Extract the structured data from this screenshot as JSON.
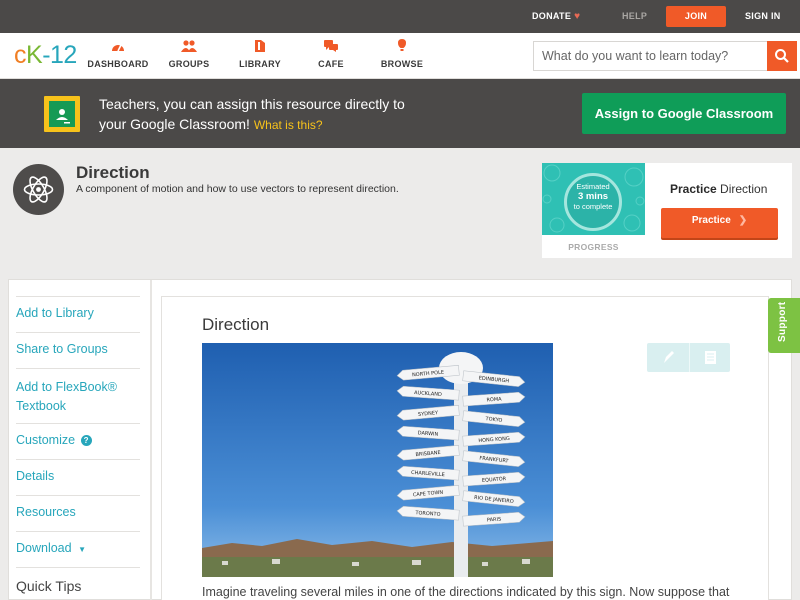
{
  "topbar": {
    "donate": "DONATE",
    "help": "HELP",
    "join": "JOIN",
    "signin": "SIGN IN"
  },
  "logo": {
    "c": "c",
    "k": "K",
    "n": "-12"
  },
  "nav": [
    {
      "label": "DASHBOARD",
      "icon": "dashboard-icon"
    },
    {
      "label": "GROUPS",
      "icon": "groups-icon"
    },
    {
      "label": "LIBRARY",
      "icon": "library-icon"
    },
    {
      "label": "CAFE",
      "icon": "cafe-icon"
    },
    {
      "label": "BROWSE",
      "icon": "browse-icon"
    }
  ],
  "search": {
    "placeholder": "What do you want to learn today?"
  },
  "banner": {
    "line1": "Teachers, you can assign this resource directly to",
    "line2": "your Google Classroom!",
    "link": "What is this?",
    "button": "Assign to Google Classroom"
  },
  "concept": {
    "title": "Direction",
    "description": "A component of motion and how to use vectors to represent direction."
  },
  "progress": {
    "estimated": "Estimated",
    "mins": "3 mins",
    "complete": "to complete",
    "label": "PROGRESS",
    "practice_bold": "Practice",
    "practice_rest": "Direction",
    "practice_button": "Practice"
  },
  "sidebar": {
    "items": [
      "Add to Library",
      "Share to Groups",
      "Add to FlexBook®",
      "Textbook",
      "Customize",
      "Details",
      "Resources",
      "Download"
    ],
    "quick_tips": "Quick Tips"
  },
  "article": {
    "title": "Direction",
    "text": "Imagine traveling several miles in one of the directions indicated by this sign. Now suppose that",
    "signs": [
      "NORTH POLE",
      "EDINBURGH",
      "AUCKLAND",
      "ROMA",
      "SYDNEY",
      "TOKYO",
      "DARWIN",
      "HONG KONG",
      "BRISBANE",
      "FRANKFURT",
      "CHARLEVILLE",
      "EQUATOR",
      "CAPE TOWN",
      "RIO DE JANEIRO",
      "TORONTO",
      "PARIS"
    ]
  },
  "support": "Support",
  "colors": {
    "accent": "#f05a28",
    "link": "#27a6bb",
    "google_green": "#0f9d58",
    "dark_bar": "#4b4948",
    "support": "#7dc243"
  }
}
